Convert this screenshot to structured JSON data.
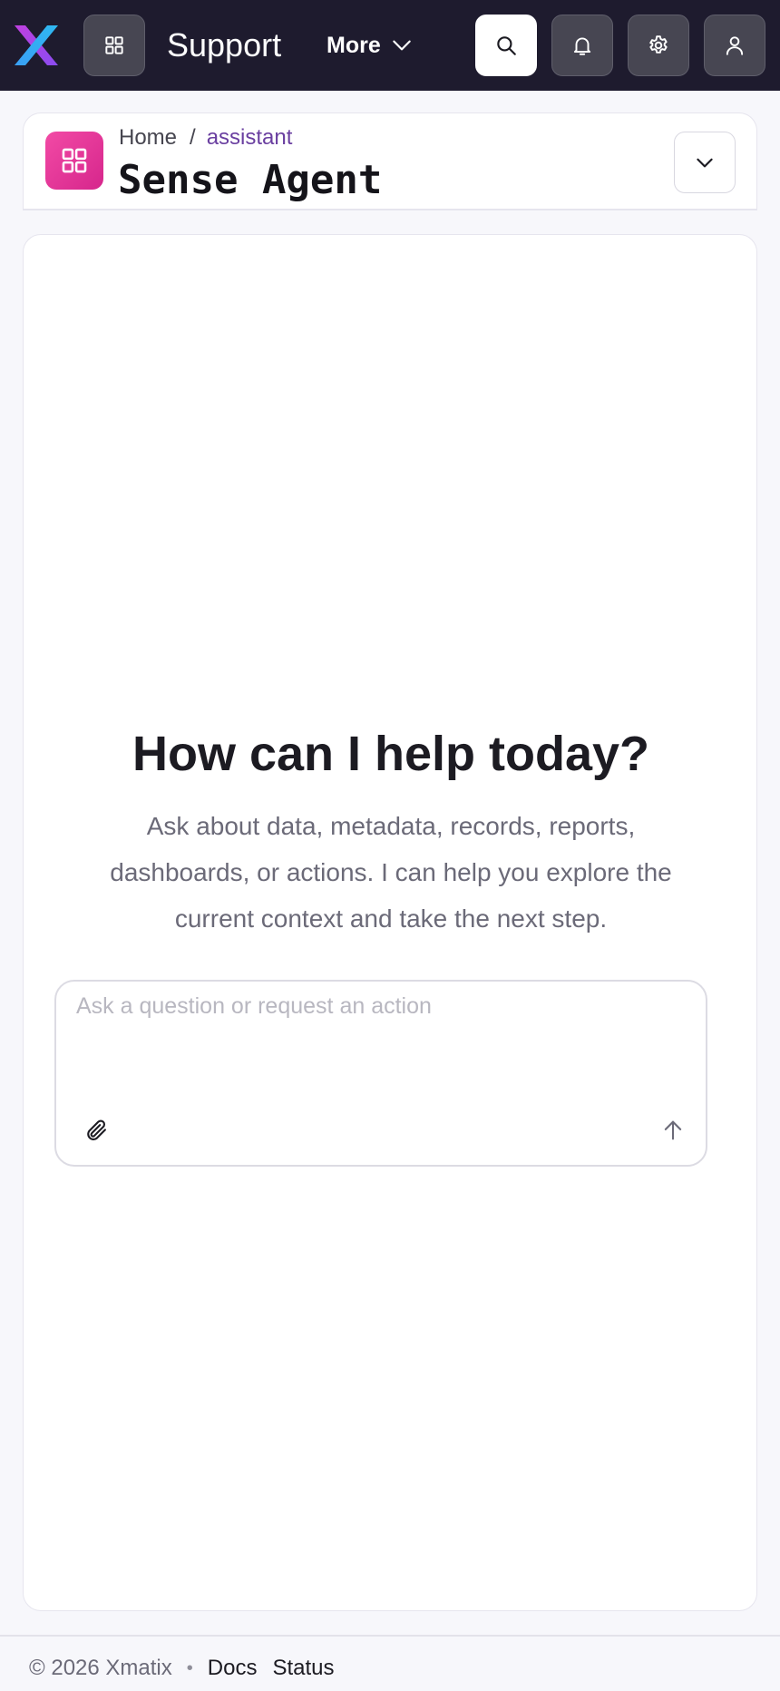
{
  "topbar": {
    "app_title": "Support",
    "more_label": "More",
    "icons": {
      "logo": "xmatix-x-logo",
      "apps": "grid-icon",
      "more": "chevron-down-icon",
      "search": "search-icon",
      "notifications": "bell-icon",
      "settings": "gear-icon",
      "account": "user-icon"
    }
  },
  "header": {
    "breadcrumb": {
      "home": "Home",
      "separator": "/",
      "current": "assistant"
    },
    "title": "Sense Agent",
    "icons": {
      "page": "grid-icon",
      "toggle": "chevron-down-icon"
    }
  },
  "chat": {
    "heading": "How can I help today?",
    "subtitle": "Ask about data, metadata, records, reports, dashboards, or actions. I can help you explore the current context and take the next step.",
    "input": {
      "value": "",
      "placeholder": "Ask a question or request an action"
    },
    "icons": {
      "attach": "paperclip-icon",
      "send": "arrow-up-icon"
    }
  },
  "footer": {
    "copyright": "© 2026 Xmatix",
    "separator": "•",
    "links": [
      "Docs",
      "Status"
    ]
  },
  "colors": {
    "topbar_bg": "#1e1b2e",
    "accent": "#6a3fa0",
    "page_icon": "#e6399b",
    "logo_magenta": "#c040e0",
    "logo_cyan": "#2fb8f0"
  }
}
